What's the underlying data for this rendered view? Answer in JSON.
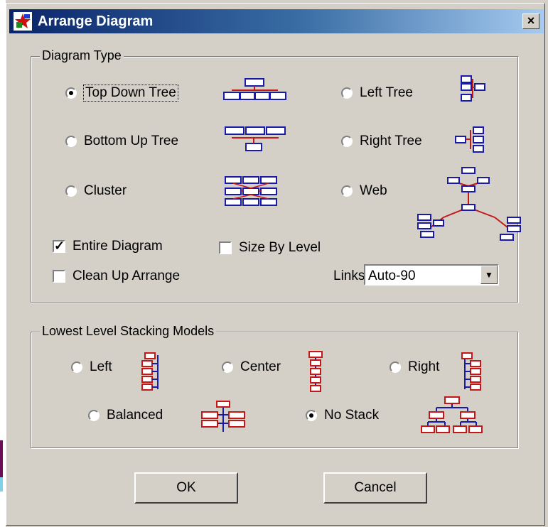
{
  "window": {
    "title": "Arrange Diagram",
    "close_glyph": "×"
  },
  "diagram_type": {
    "legend": "Diagram Type",
    "options": [
      {
        "label": "Top Down Tree",
        "selected": true
      },
      {
        "label": "Left Tree",
        "selected": false
      },
      {
        "label": "Bottom Up Tree",
        "selected": false
      },
      {
        "label": "Right Tree",
        "selected": false
      },
      {
        "label": "Cluster",
        "selected": false
      },
      {
        "label": "Web",
        "selected": false
      }
    ],
    "entire_diagram": {
      "label": "Entire Diagram",
      "checked": true
    },
    "size_by_level": {
      "label": "Size By Level",
      "checked": false
    },
    "clean_up_arrange": {
      "label": "Clean Up Arrange",
      "checked": false
    },
    "links": {
      "label": "Links",
      "value": "Auto-90"
    }
  },
  "stacking": {
    "legend": "Lowest Level Stacking Models",
    "options": [
      {
        "label": "Left",
        "selected": false
      },
      {
        "label": "Center",
        "selected": false
      },
      {
        "label": "Right",
        "selected": false
      },
      {
        "label": "Balanced",
        "selected": false
      },
      {
        "label": "No Stack",
        "selected": true
      }
    ]
  },
  "buttons": {
    "ok": "OK",
    "cancel": "Cancel"
  },
  "colors": {
    "titlebar_start": "#0a246a",
    "titlebar_end": "#a6caf0",
    "face": "#d4d0c8",
    "icon_blue": "#1a1aa8",
    "icon_red": "#c41818"
  }
}
